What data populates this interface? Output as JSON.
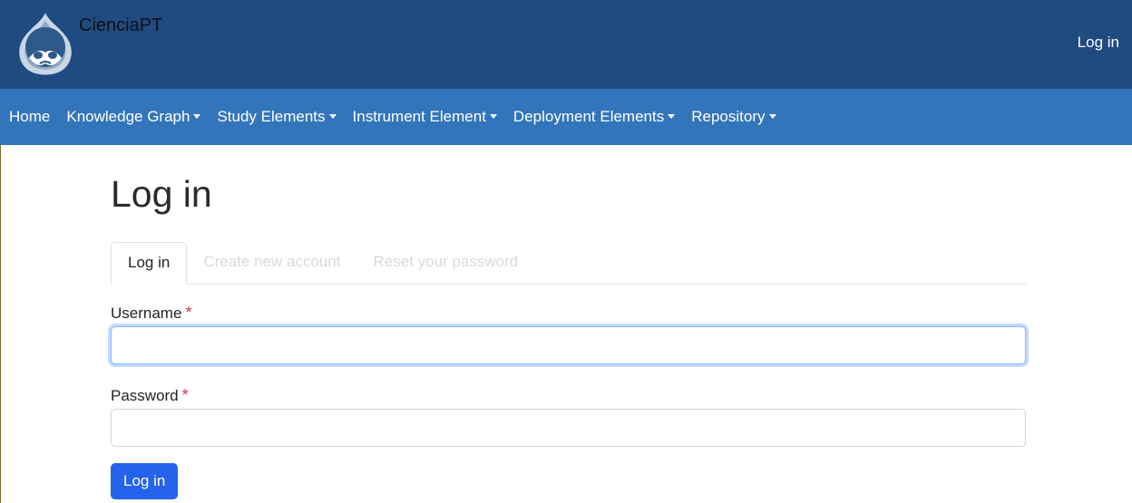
{
  "header": {
    "site_name": "CienciaPT",
    "login_link": "Log in",
    "colors": {
      "header_bg": "#1f4b80",
      "nav_bg": "#3375bb"
    },
    "logo_icon": "drupal-drop-icon"
  },
  "nav": {
    "items": [
      {
        "label": "Home",
        "dropdown": false
      },
      {
        "label": "Knowledge Graph",
        "dropdown": true
      },
      {
        "label": "Study Elements",
        "dropdown": true
      },
      {
        "label": "Instrument Element",
        "dropdown": true
      },
      {
        "label": "Deployment Elements",
        "dropdown": true
      },
      {
        "label": "Repository",
        "dropdown": true
      }
    ]
  },
  "main": {
    "title": "Log in",
    "tabs": [
      {
        "label": "Log in",
        "active": true
      },
      {
        "label": "Create new account",
        "active": false
      },
      {
        "label": "Reset your password",
        "active": false
      }
    ],
    "form": {
      "username_label": "Username",
      "username_value": "",
      "password_label": "Password",
      "password_value": "",
      "required_marker": "*",
      "submit_label": "Log in"
    }
  }
}
